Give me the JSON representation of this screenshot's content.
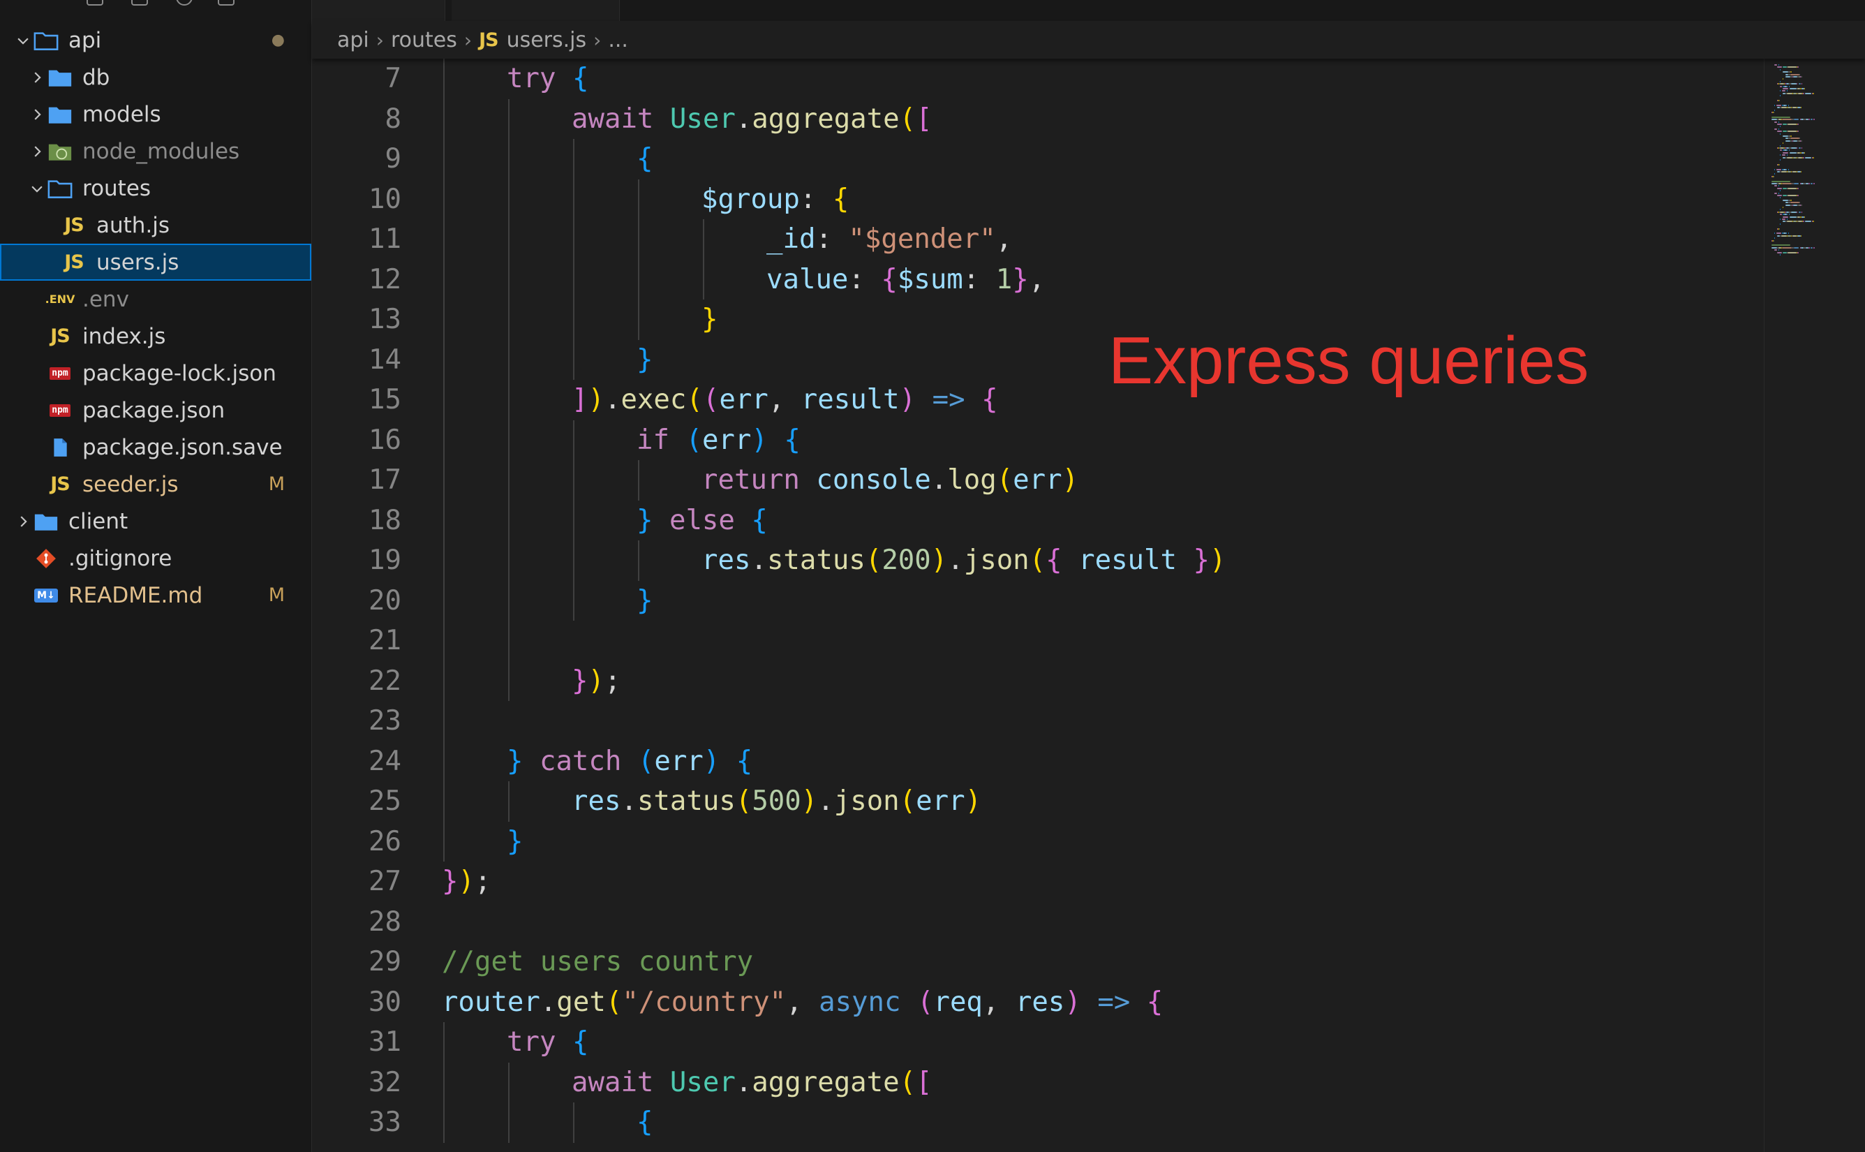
{
  "explorer": {
    "items": [
      {
        "label": "api",
        "icon": "folder-open-icon",
        "chevron": "down",
        "badge": "●",
        "kind": "folder"
      },
      {
        "label": "db",
        "icon": "folder-icon",
        "chevron": "right",
        "kind": "folder"
      },
      {
        "label": "models",
        "icon": "folder-icon",
        "chevron": "right",
        "kind": "folder"
      },
      {
        "label": "node_modules",
        "icon": "node-folder-icon",
        "chevron": "right",
        "kind": "folder",
        "dim": true
      },
      {
        "label": "routes",
        "icon": "folder-open-icon",
        "chevron": "down",
        "kind": "folder"
      },
      {
        "label": "auth.js",
        "icon": "js-file-icon",
        "kind": "file"
      },
      {
        "label": "users.js",
        "icon": "js-file-icon",
        "kind": "file",
        "selected": true
      },
      {
        "label": ".env",
        "icon": "env-file-icon",
        "kind": "file",
        "dim": true
      },
      {
        "label": "index.js",
        "icon": "js-file-icon",
        "kind": "file"
      },
      {
        "label": "package-lock.json",
        "icon": "npm-icon",
        "kind": "file"
      },
      {
        "label": "package.json",
        "icon": "npm-icon",
        "kind": "file"
      },
      {
        "label": "package.json.save",
        "icon": "file-icon",
        "kind": "file"
      },
      {
        "label": "seeder.js",
        "icon": "js-file-icon",
        "kind": "file",
        "badge": "M",
        "modified": true
      },
      {
        "label": "client",
        "icon": "folder-icon",
        "chevron": "right",
        "kind": "folder"
      },
      {
        "label": ".gitignore",
        "icon": "git-icon",
        "kind": "file"
      },
      {
        "label": "README.md",
        "icon": "markdown-icon",
        "kind": "file",
        "badge": "M",
        "modified": true
      }
    ],
    "icon_glyphs": {
      "js": "JS",
      "npm": "npm",
      "env": ".ENV",
      "md": "M↓"
    }
  },
  "breadcrumb": {
    "parts": [
      "api",
      "routes",
      "users.js",
      "..."
    ]
  },
  "annotation": "Express queries",
  "editor": {
    "lines": [
      {
        "n": "7",
        "indent": 1,
        "tokens": [
          [
            "try",
            "kw"
          ],
          [
            " ",
            "pl"
          ],
          [
            "{",
            "b3"
          ]
        ]
      },
      {
        "n": "8",
        "indent": 2,
        "tokens": [
          [
            "await",
            "kw"
          ],
          [
            " ",
            "pl"
          ],
          [
            "User",
            "cls"
          ],
          [
            ".",
            "pl"
          ],
          [
            "aggregate",
            "fn"
          ],
          [
            "(",
            "b1"
          ],
          [
            "[",
            "b2"
          ]
        ]
      },
      {
        "n": "9",
        "indent": 3,
        "tokens": [
          [
            "{",
            "b3"
          ]
        ]
      },
      {
        "n": "10",
        "indent": 4,
        "tokens": [
          [
            "$group",
            "prop"
          ],
          [
            ": ",
            "pl"
          ],
          [
            "{",
            "b1"
          ]
        ]
      },
      {
        "n": "11",
        "indent": 5,
        "tokens": [
          [
            "_id",
            "prop"
          ],
          [
            ": ",
            "pl"
          ],
          [
            "\"$gender\"",
            "str"
          ],
          [
            ",",
            "pl"
          ]
        ]
      },
      {
        "n": "12",
        "indent": 5,
        "tokens": [
          [
            "value",
            "prop"
          ],
          [
            ": ",
            "pl"
          ],
          [
            "{",
            "b2"
          ],
          [
            "$sum",
            "prop"
          ],
          [
            ": ",
            "pl"
          ],
          [
            "1",
            "num"
          ],
          [
            "}",
            "b2"
          ],
          [
            ",",
            "pl"
          ]
        ]
      },
      {
        "n": "13",
        "indent": 4,
        "tokens": [
          [
            "}",
            "b1"
          ]
        ]
      },
      {
        "n": "14",
        "indent": 3,
        "tokens": [
          [
            "}",
            "b3"
          ]
        ]
      },
      {
        "n": "15",
        "indent": 2,
        "tokens": [
          [
            "]",
            "b2"
          ],
          [
            ")",
            "b1"
          ],
          [
            ".",
            "pl"
          ],
          [
            "exec",
            "fn"
          ],
          [
            "(",
            "b1"
          ],
          [
            "(",
            "b2"
          ],
          [
            "err",
            "var"
          ],
          [
            ", ",
            "pl"
          ],
          [
            "result",
            "var"
          ],
          [
            ")",
            "b2"
          ],
          [
            " ",
            "pl"
          ],
          [
            "=>",
            "kw2"
          ],
          [
            " ",
            "pl"
          ],
          [
            "{",
            "b2"
          ]
        ]
      },
      {
        "n": "16",
        "indent": 3,
        "tokens": [
          [
            "if",
            "kw"
          ],
          [
            " ",
            "pl"
          ],
          [
            "(",
            "b3"
          ],
          [
            "err",
            "var"
          ],
          [
            ")",
            "b3"
          ],
          [
            " ",
            "pl"
          ],
          [
            "{",
            "b3"
          ]
        ]
      },
      {
        "n": "17",
        "indent": 4,
        "tokens": [
          [
            "return",
            "kw"
          ],
          [
            " ",
            "pl"
          ],
          [
            "console",
            "var"
          ],
          [
            ".",
            "pl"
          ],
          [
            "log",
            "fn"
          ],
          [
            "(",
            "b1"
          ],
          [
            "err",
            "var"
          ],
          [
            ")",
            "b1"
          ]
        ]
      },
      {
        "n": "18",
        "indent": 3,
        "tokens": [
          [
            "}",
            "b3"
          ],
          [
            " ",
            "pl"
          ],
          [
            "else",
            "kw"
          ],
          [
            " ",
            "pl"
          ],
          [
            "{",
            "b3"
          ]
        ]
      },
      {
        "n": "19",
        "indent": 4,
        "tokens": [
          [
            "res",
            "var"
          ],
          [
            ".",
            "pl"
          ],
          [
            "status",
            "fn"
          ],
          [
            "(",
            "b1"
          ],
          [
            "200",
            "num"
          ],
          [
            ")",
            "b1"
          ],
          [
            ".",
            "pl"
          ],
          [
            "json",
            "fn"
          ],
          [
            "(",
            "b1"
          ],
          [
            "{",
            "b2"
          ],
          [
            " ",
            "pl"
          ],
          [
            "result",
            "var"
          ],
          [
            " ",
            "pl"
          ],
          [
            "}",
            "b2"
          ],
          [
            ")",
            "b1"
          ]
        ]
      },
      {
        "n": "20",
        "indent": 3,
        "tokens": [
          [
            "}",
            "b3"
          ]
        ]
      },
      {
        "n": "21",
        "indent": 2,
        "tokens": []
      },
      {
        "n": "22",
        "indent": 2,
        "tokens": [
          [
            "}",
            "b2"
          ],
          [
            ")",
            "b1"
          ],
          [
            ";",
            "pl"
          ]
        ]
      },
      {
        "n": "23",
        "indent": 1,
        "tokens": []
      },
      {
        "n": "24",
        "indent": 1,
        "tokens": [
          [
            "}",
            "b3"
          ],
          [
            " ",
            "pl"
          ],
          [
            "catch",
            "kw"
          ],
          [
            " ",
            "pl"
          ],
          [
            "(",
            "b3"
          ],
          [
            "err",
            "var"
          ],
          [
            ")",
            "b3"
          ],
          [
            " ",
            "pl"
          ],
          [
            "{",
            "b3"
          ]
        ]
      },
      {
        "n": "25",
        "indent": 2,
        "tokens": [
          [
            "res",
            "var"
          ],
          [
            ".",
            "pl"
          ],
          [
            "status",
            "fn"
          ],
          [
            "(",
            "b1"
          ],
          [
            "500",
            "num"
          ],
          [
            ")",
            "b1"
          ],
          [
            ".",
            "pl"
          ],
          [
            "json",
            "fn"
          ],
          [
            "(",
            "b1"
          ],
          [
            "err",
            "var"
          ],
          [
            ")",
            "b1"
          ]
        ]
      },
      {
        "n": "26",
        "indent": 1,
        "tokens": [
          [
            "}",
            "b3"
          ]
        ]
      },
      {
        "n": "27",
        "indent": 0,
        "tokens": [
          [
            "}",
            "b2"
          ],
          [
            ")",
            "b1"
          ],
          [
            ";",
            "pl"
          ]
        ]
      },
      {
        "n": "28",
        "indent": 0,
        "tokens": []
      },
      {
        "n": "29",
        "indent": 0,
        "tokens": [
          [
            "//get users country",
            "cmt"
          ]
        ]
      },
      {
        "n": "30",
        "indent": 0,
        "tokens": [
          [
            "router",
            "var"
          ],
          [
            ".",
            "pl"
          ],
          [
            "get",
            "fn"
          ],
          [
            "(",
            "b1"
          ],
          [
            "\"/country\"",
            "str"
          ],
          [
            ", ",
            "pl"
          ],
          [
            "async",
            "kw2"
          ],
          [
            " ",
            "pl"
          ],
          [
            "(",
            "b2"
          ],
          [
            "req",
            "var"
          ],
          [
            ", ",
            "pl"
          ],
          [
            "res",
            "var"
          ],
          [
            ")",
            "b2"
          ],
          [
            " ",
            "pl"
          ],
          [
            "=>",
            "kw2"
          ],
          [
            " ",
            "pl"
          ],
          [
            "{",
            "b2"
          ]
        ]
      },
      {
        "n": "31",
        "indent": 1,
        "tokens": [
          [
            "try",
            "kw"
          ],
          [
            " ",
            "pl"
          ],
          [
            "{",
            "b3"
          ]
        ]
      },
      {
        "n": "32",
        "indent": 2,
        "tokens": [
          [
            "await",
            "kw"
          ],
          [
            " ",
            "pl"
          ],
          [
            "User",
            "cls"
          ],
          [
            ".",
            "pl"
          ],
          [
            "aggregate",
            "fn"
          ],
          [
            "(",
            "b1"
          ],
          [
            "[",
            "b2"
          ]
        ]
      },
      {
        "n": "33",
        "indent": 3,
        "tokens": [
          [
            "{",
            "b3"
          ]
        ]
      }
    ]
  }
}
